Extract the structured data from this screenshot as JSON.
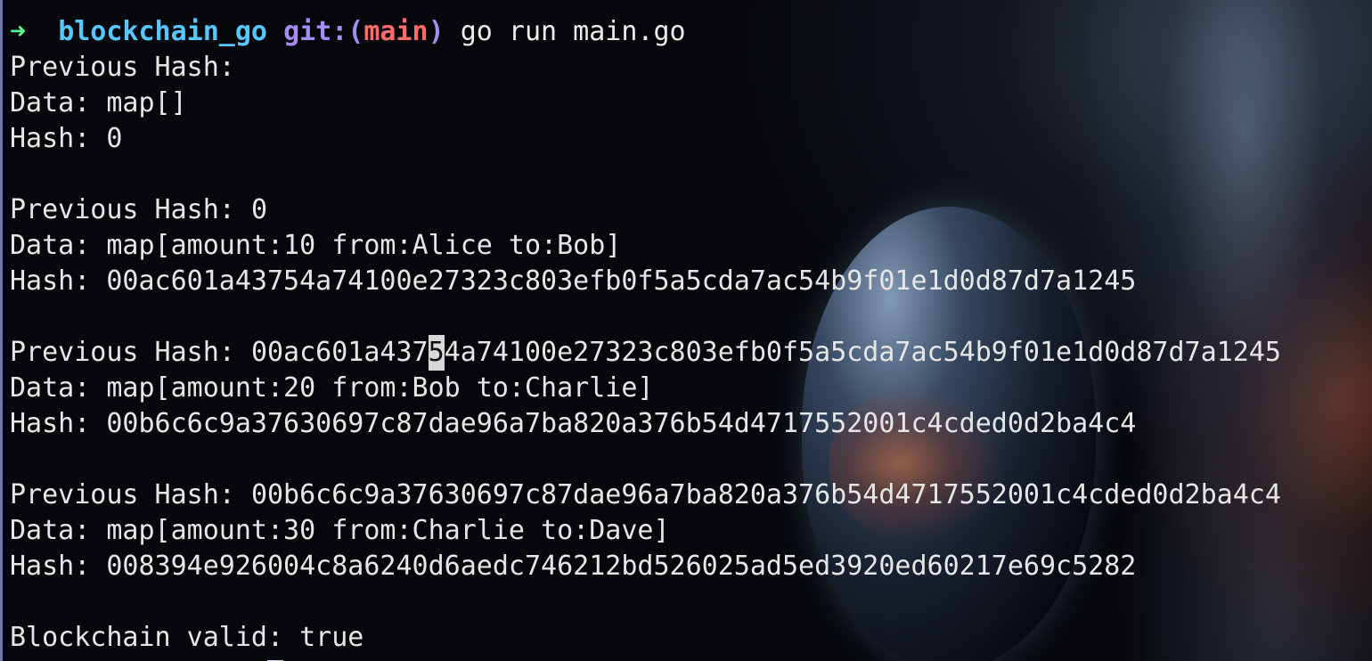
{
  "terminal": {
    "prompt": {
      "arrow": "➜",
      "directory": "blockchain_go",
      "git_label": "git:(",
      "branch": "main",
      "git_close": ")",
      "command": "go run main.go"
    },
    "blocks": [
      {
        "previous_hash_label": "Previous Hash:",
        "previous_hash": "",
        "data_label": "Data:",
        "data": "map[]",
        "hash_label": "Hash:",
        "hash": "0"
      },
      {
        "previous_hash_label": "Previous Hash:",
        "previous_hash": "0",
        "data_label": "Data:",
        "data": "map[amount:10 from:Alice to:Bob]",
        "hash_label": "Hash:",
        "hash": "00ac601a43754a74100e27323c803efb0f5a5cda7ac54b9f01e1d0d87d7a1245"
      },
      {
        "previous_hash_label": "Previous Hash:",
        "previous_hash_before_cursor": "00ac601a437",
        "previous_hash_cursor_char": "5",
        "previous_hash_after_cursor": "4a74100e27323c803efb0f5a5cda7ac54b9f01e1d0d87d7a1245",
        "data_label": "Data:",
        "data": "map[amount:20 from:Bob to:Charlie]",
        "hash_label": "Hash:",
        "hash": "00b6c6c9a37630697c87dae96a7ba820a376b54d4717552001c4cded0d2ba4c4"
      },
      {
        "previous_hash_label": "Previous Hash:",
        "previous_hash": "00b6c6c9a37630697c87dae96a7ba820a376b54d4717552001c4cded0d2ba4c4",
        "data_label": "Data:",
        "data": "map[amount:30 from:Charlie to:Dave]",
        "hash_label": "Hash:",
        "hash": "008394e926004c8a6240d6aedc746212bd526025ad5ed3920ed60217e69c5282"
      }
    ],
    "result_label": "Blockchain valid:",
    "result_value": "true"
  },
  "colors": {
    "background": "#05070b",
    "text": "#e6e6e6",
    "prompt_arrow": "#5af78e",
    "prompt_directory": "#57c7ff",
    "prompt_git": "#a48cf2",
    "prompt_branch": "#ff6c6b",
    "cursor": "#c9cdf5"
  }
}
